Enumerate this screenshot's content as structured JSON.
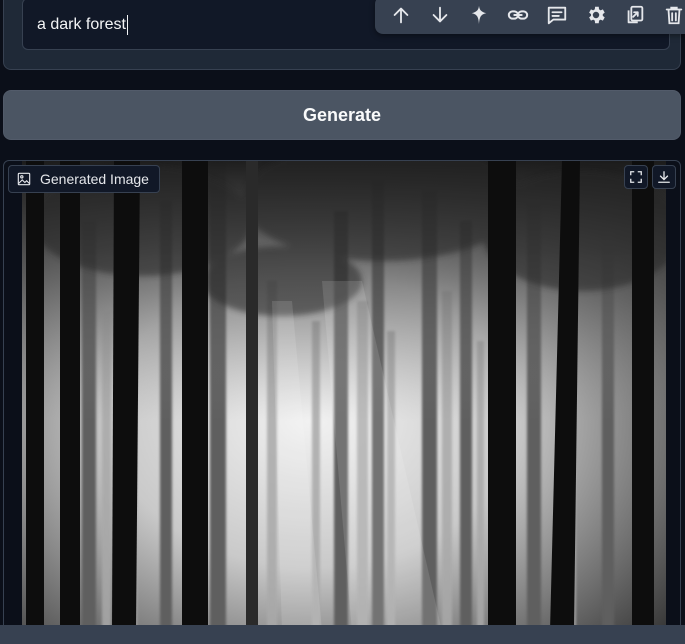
{
  "prompt": {
    "value": "a  dark forest"
  },
  "toolbar": {
    "buttons": [
      {
        "icon": "arrow-up-icon"
      },
      {
        "icon": "arrow-down-icon"
      },
      {
        "icon": "sparkle-icon"
      },
      {
        "icon": "link-icon"
      },
      {
        "icon": "comment-icon"
      },
      {
        "icon": "gear-icon"
      },
      {
        "icon": "copy-icon"
      },
      {
        "icon": "trash-icon"
      }
    ]
  },
  "generate": {
    "label": "Generate"
  },
  "output": {
    "label": "Generated Image",
    "image_description_icon": "image-icon"
  },
  "colors": {
    "background": "#0b0f19",
    "panel": "#1f2937",
    "button": "#4b5563",
    "toolbar": "#374151",
    "text": "#f3f4f6"
  }
}
